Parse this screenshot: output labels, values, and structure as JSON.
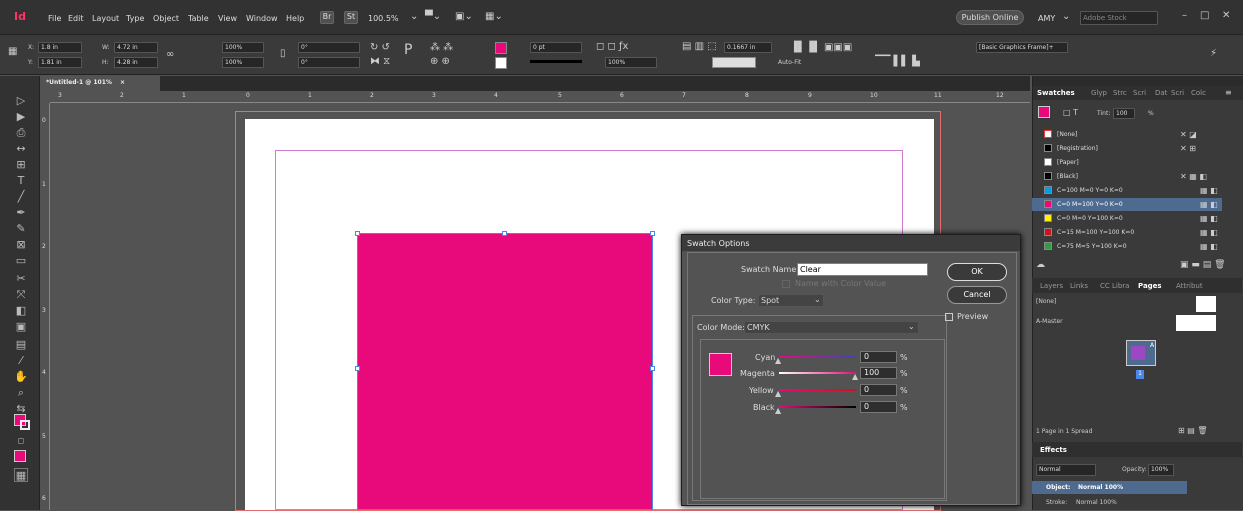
{
  "app": {
    "logo": "Id",
    "menus": [
      "File",
      "Edit",
      "Layout",
      "Type",
      "Object",
      "Table",
      "View",
      "Window",
      "Help"
    ],
    "bridge": "Br",
    "stock": "St",
    "zoom": "100.5%",
    "publish": "Publish Online",
    "user": "AMY",
    "search_placeholder": "Adobe Stock"
  },
  "control": {
    "x_label": "X:",
    "x_value": "1.8 in",
    "y_label": "Y:",
    "y_value": "1.81 in",
    "w_label": "W:",
    "w_value": "4.72 in",
    "h_label": "H:",
    "h_value": "4.28 in",
    "scale_x": "100%",
    "scale_y": "100%",
    "rotate": "0°",
    "shear": "0°",
    "stroke": "0 pt",
    "opacity": "100%",
    "offset": "0.1667 in",
    "style": "[Basic Graphics Frame]+",
    "autofit": "Auto-Fit"
  },
  "document": {
    "tab": "*Untitled-1 @ 101%",
    "close": "×",
    "hruler": [
      "3",
      "2",
      "1",
      "0",
      "1",
      "2",
      "3",
      "4",
      "5",
      "6",
      "7",
      "8",
      "9",
      "10",
      "11",
      "12"
    ],
    "vruler": [
      "0",
      "1",
      "2",
      "3",
      "4",
      "5",
      "6"
    ]
  },
  "dialog": {
    "title": "Swatch Options",
    "name_label": "Swatch Name:",
    "name_value": "Clear",
    "name_with_value": "Name with Color Value",
    "type_label": "Color Type:",
    "type_value": "Spot",
    "mode_label": "Color Mode:",
    "mode_value": "CMYK",
    "ok": "OK",
    "cancel": "Cancel",
    "preview": "Preview",
    "cyan_label": "Cyan",
    "cyan_value": "0",
    "magenta_label": "Magenta",
    "magenta_value": "100",
    "yellow_label": "Yellow",
    "yellow_value": "0",
    "black_label": "Black",
    "black_value": "0",
    "pct": "%"
  },
  "swatches_panel": {
    "tabs": [
      "Swatches",
      "Glyp",
      "Strc",
      "Scri",
      "Dat",
      "Scri",
      "Colc"
    ],
    "tint_label": "Tint:",
    "tint_value": "100",
    "tint_pct": "%",
    "items": [
      {
        "name": "[None]",
        "color": "#ffffff"
      },
      {
        "name": "[Registration]",
        "color": "#000000"
      },
      {
        "name": "[Paper]",
        "color": "#ffffff"
      },
      {
        "name": "[Black]",
        "color": "#000000"
      },
      {
        "name": "C=100 M=0 Y=0 K=0",
        "color": "#00a0e9"
      },
      {
        "name": "C=0 M=100 Y=0 K=0",
        "color": "#e8097b"
      },
      {
        "name": "C=0 M=0 Y=100 K=0",
        "color": "#fff100"
      },
      {
        "name": "C=15 M=100 Y=100 K=0",
        "color": "#d0121b"
      },
      {
        "name": "C=75 M=5 Y=100 K=0",
        "color": "#2aa13b"
      }
    ]
  },
  "pages_panel": {
    "tabs": [
      "Layers",
      "Links",
      "CC Libra",
      "Pages",
      "Attribut"
    ],
    "none": "[None]",
    "master": "A-Master",
    "page_letter": "A",
    "page_num": "1",
    "status": "1 Page in 1 Spread"
  },
  "effects_panel": {
    "title": "Effects",
    "mode": "Normal",
    "opacity_label": "Opacity:",
    "opacity_value": "100%",
    "object_label": "Object:",
    "object_value": "Normal 100%",
    "stroke_label": "Stroke:",
    "stroke_value": "Normal 100%"
  },
  "colors": {
    "magenta": "#e8097b",
    "accent": "#4a87e8"
  }
}
